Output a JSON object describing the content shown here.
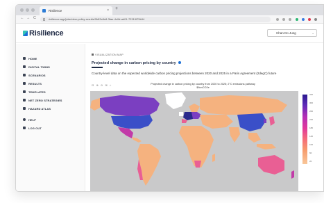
{
  "browser": {
    "tab_title": "Risilience",
    "tab_close": "×",
    "new_tab": "+",
    "nav_back": "←",
    "nav_forward": "→",
    "nav_reload": "C",
    "url": "risilience.app/jobs/view-policy-results/2b83c8d4-3fae-4c0d-ab01-72319f75b94"
  },
  "app": {
    "logo_text": "Risilience",
    "user_name": "Chan Do Jung",
    "user_chevron": "⌄"
  },
  "sidebar": {
    "items": [
      {
        "label": "HOME",
        "icon": "home-icon"
      },
      {
        "label": "DIGITAL TWINS",
        "icon": "grid-icon"
      },
      {
        "label": "SCENARIOS",
        "icon": "scenario-icon"
      },
      {
        "label": "RESULTS",
        "icon": "results-icon"
      },
      {
        "label": "TEMPLATES",
        "icon": "template-icon"
      },
      {
        "label": "NET ZERO STRATEGIES",
        "icon": "chart-icon"
      },
      {
        "label": "HAZARD ATLAS",
        "icon": "globe-icon"
      },
      {
        "label": "HELP",
        "icon": "help-icon"
      },
      {
        "label": "LOG OUT",
        "icon": "logout-icon"
      }
    ]
  },
  "main": {
    "breadcrumb": "VISUALIZATION MAP",
    "page_title": "Projected change in carbon pricing by country",
    "description": "Country-level data on the expected worldwide carbon pricing projections between 2020 and 2025 in a Paris Agreement (2degC) future"
  },
  "map": {
    "tools": "⊟ ⊕ ⊖ ⊞ ⌂",
    "title": "Projected change in carbon pricing by country from 2020 to 2025; 2°C emissions pathway",
    "subtitle": "$/tonCO2e",
    "scale_ticks": [
      "340",
      "300",
      "260",
      "220",
      "180",
      "140",
      "100",
      "60",
      "20"
    ],
    "colors": {
      "ocean": "#c9c9ca",
      "land": "#f5b27f",
      "purple": "#7b3fc1",
      "blue": "#3a4fc8",
      "magenta": "#c23aa8",
      "pink": "#e95f94",
      "navy": "#2a2a8c",
      "white": "#ffffff"
    }
  }
}
